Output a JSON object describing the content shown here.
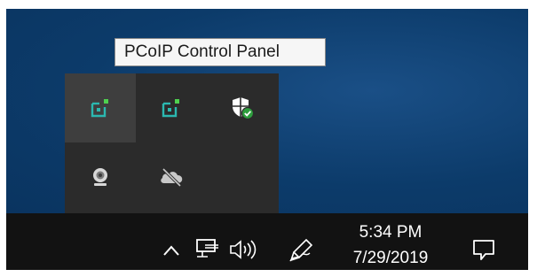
{
  "tooltip": {
    "text": "PCoIP Control Panel"
  },
  "tray_flyout": {
    "items": [
      {
        "icon": "pcoip-icon",
        "state": "hovered"
      },
      {
        "icon": "pcoip-icon"
      },
      {
        "icon": "windows-security-icon"
      },
      {
        "icon": "webcam-icon"
      },
      {
        "icon": "onedrive-offline-icon"
      }
    ]
  },
  "taskbar": {
    "icons": [
      "show-hidden-icons-chevron-icon",
      "network-icon",
      "volume-icon",
      "pen-workspace-icon",
      "action-center-icon"
    ],
    "clock": {
      "time": "5:34 PM",
      "date": "7/29/2019"
    }
  },
  "colors": {
    "desktop": "#0b3d6f",
    "taskbar": "#121212",
    "flyout": "#2b2b2b",
    "pcoip_teal": "#2bb8b0",
    "pcoip_green": "#4fd04f",
    "security_green": "#2e9e3e"
  }
}
